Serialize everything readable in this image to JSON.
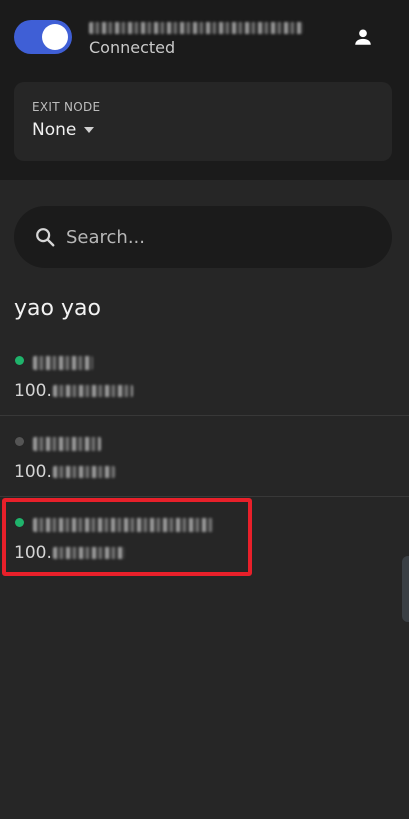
{
  "header": {
    "status": "Connected",
    "connected": true,
    "profile_icon": "person-icon"
  },
  "exit_node": {
    "label": "EXIT NODE",
    "value": "None"
  },
  "search": {
    "placeholder": "Search..."
  },
  "owner": "yao yao",
  "devices": [
    {
      "ip_prefix": "100.",
      "online": true,
      "status_color": "#1fb36b"
    },
    {
      "ip_prefix": "100.",
      "online": false,
      "status_color": "#555555"
    },
    {
      "ip_prefix": "100.",
      "online": true,
      "status_color": "#1fb36b"
    }
  ],
  "colors": {
    "accent": "#3f5fd6",
    "online": "#1fb36b",
    "highlight": "#e8202a"
  }
}
